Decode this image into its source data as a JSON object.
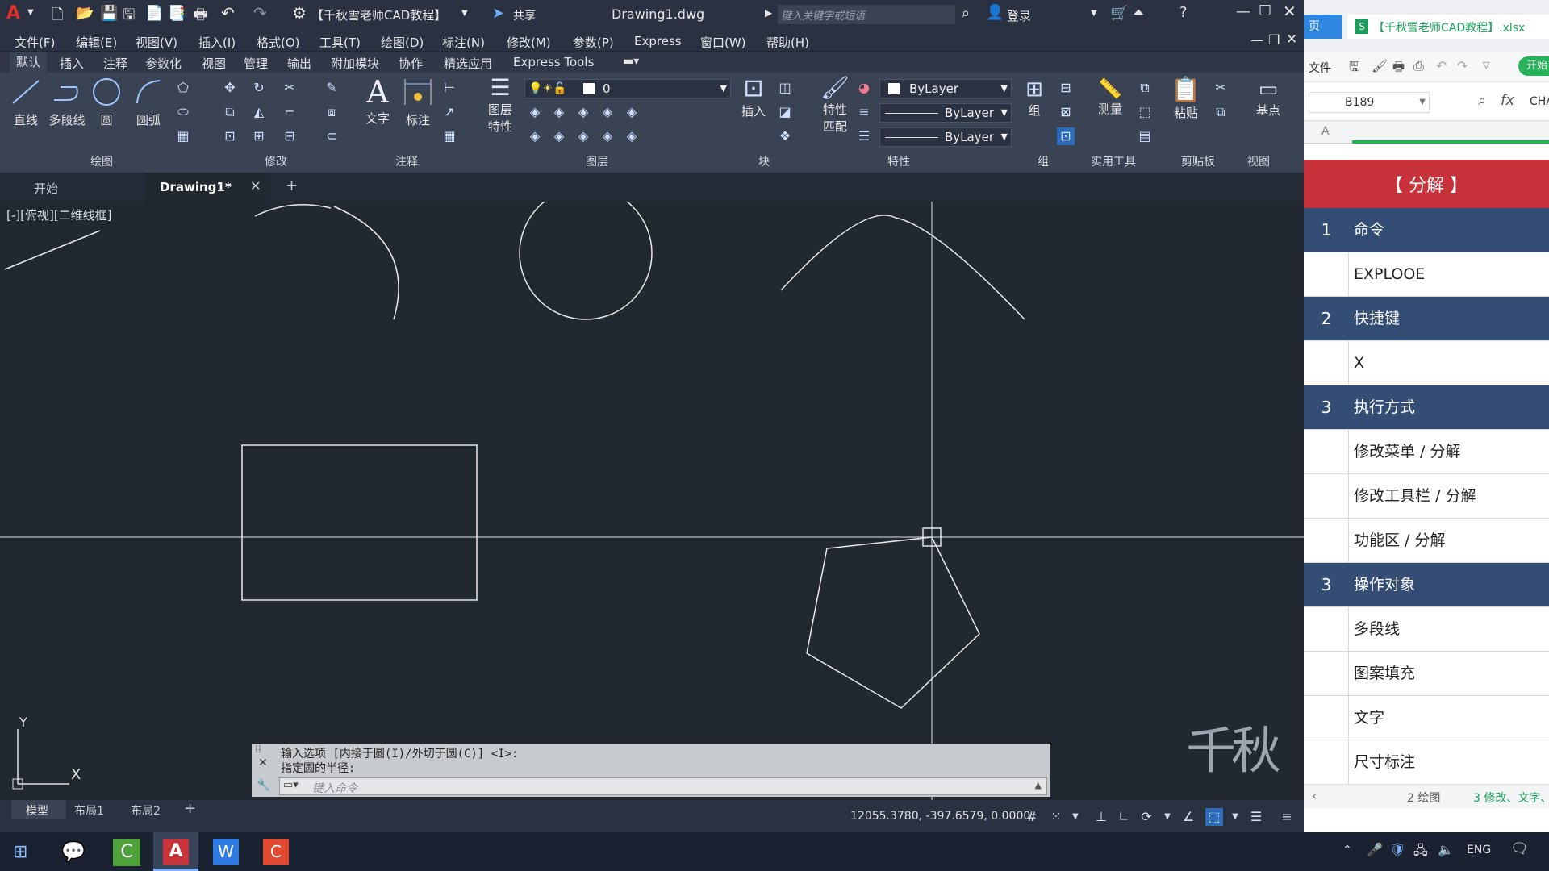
{
  "titlebar": {
    "workspace": "【千秋雪老师CAD教程】",
    "share": "共享",
    "filename": "Drawing1.dwg",
    "search_placeholder": "键入关键字或短语",
    "login": "登录"
  },
  "menubar": [
    "文件(F)",
    "编辑(E)",
    "视图(V)",
    "插入(I)",
    "格式(O)",
    "工具(T)",
    "绘图(D)",
    "标注(N)",
    "修改(M)",
    "参数(P)",
    "Express",
    "窗口(W)",
    "帮助(H)"
  ],
  "ribbon_tabs": [
    "默认",
    "插入",
    "注释",
    "参数化",
    "视图",
    "管理",
    "输出",
    "附加模块",
    "协作",
    "精选应用",
    "Express Tools"
  ],
  "ribbon": {
    "draw_tools": [
      "直线",
      "多段线",
      "圆",
      "圆弧"
    ],
    "text_tool": "文字",
    "dim_tool": "标注",
    "layer_props": [
      "图层",
      "特性"
    ],
    "layer_value": "0",
    "insert": "插入",
    "match_props": [
      "特性",
      "匹配"
    ],
    "bylayer": [
      "ByLayer",
      "ByLayer",
      "ByLayer"
    ],
    "group": "组",
    "measure": "测量",
    "paste": "粘贴",
    "basepoint": "基点",
    "panels": [
      "绘图",
      "修改",
      "注释",
      "图层",
      "块",
      "特性",
      "组",
      "实用工具",
      "剪贴板",
      "视图"
    ]
  },
  "doc_tabs": {
    "start": "开始",
    "drawing": "Drawing1*"
  },
  "viewport_label": "[-][俯视][二维线框]",
  "command": {
    "line1": "输入选项 [内接于圆(I)/外切于圆(C)] <I>:",
    "line2": "指定圆的半径:",
    "placeholder": "键入命令"
  },
  "layout_tabs": [
    "模型",
    "布局1",
    "布局2"
  ],
  "status": {
    "coords": "12055.3780, -397.6579, 0.0000"
  },
  "watermark": "千秋雪",
  "ucs": {
    "x": "X",
    "y": "Y"
  },
  "excel": {
    "tab_left": "页",
    "title": "【千秋雪老师CAD教程】.xlsx",
    "file_menu": "文件",
    "start_btn": "开始",
    "cell_ref": "B189",
    "fx": "fx",
    "formula_preview": "CHA",
    "col_a": "A",
    "header": "【 分解 】",
    "rows": [
      {
        "num": "1",
        "text": "命令",
        "head": true
      },
      {
        "num": "",
        "text": "EXPLOOE",
        "head": false
      },
      {
        "num": "2",
        "text": "快捷键",
        "head": true
      },
      {
        "num": "",
        "text": "X",
        "head": false
      },
      {
        "num": "3",
        "text": "执行方式",
        "head": true
      },
      {
        "num": "",
        "text": "修改菜单 / 分解",
        "head": false
      },
      {
        "num": "",
        "text": "修改工具栏 / 分解",
        "head": false
      },
      {
        "num": "",
        "text": "功能区 / 分解",
        "head": false
      },
      {
        "num": "3",
        "text": "操作对象",
        "head": true
      },
      {
        "num": "",
        "text": "多段线",
        "head": false
      },
      {
        "num": "",
        "text": "图案填充",
        "head": false
      },
      {
        "num": "",
        "text": "文字",
        "head": false
      },
      {
        "num": "",
        "text": "尺寸标注",
        "head": false
      }
    ],
    "sheet_tabs": [
      "2 绘图",
      "3 修改、文字、"
    ]
  },
  "taskbar": {
    "lang": "ENG"
  },
  "colors": {
    "canvas": "#212830",
    "excel_header_red": "#c8323a",
    "excel_head_blue": "#344d74"
  }
}
